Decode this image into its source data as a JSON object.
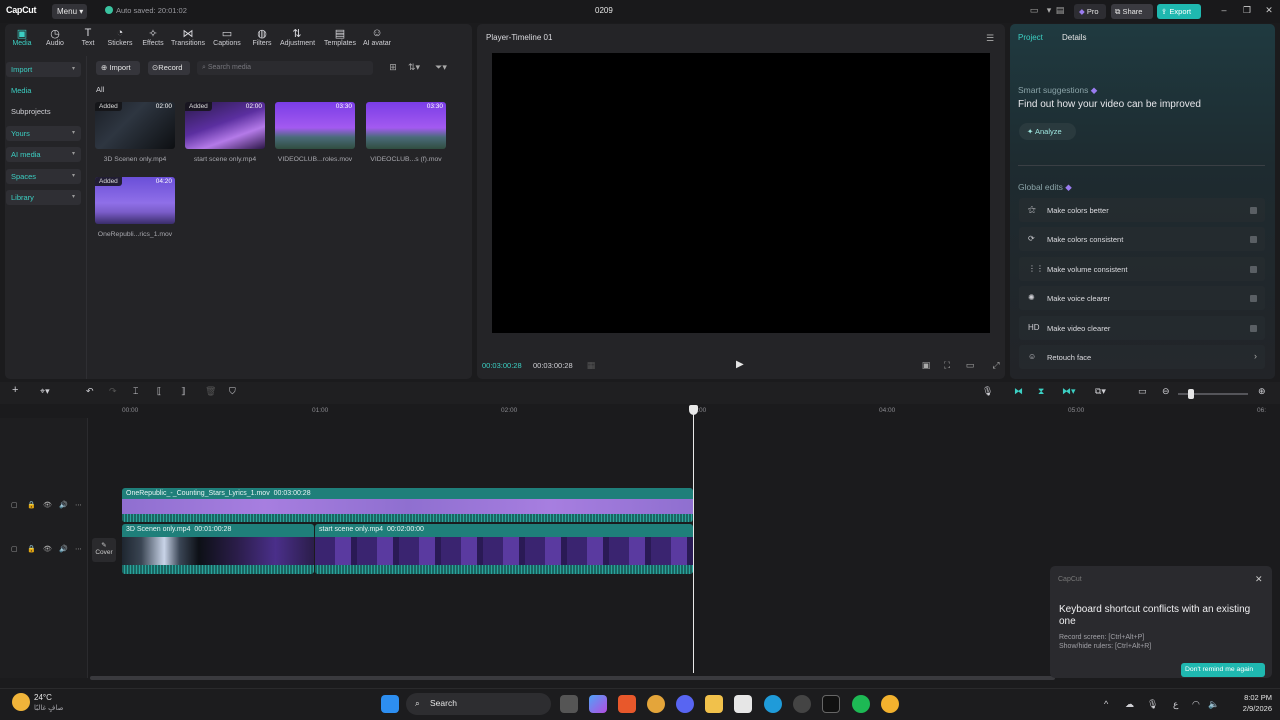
{
  "titlebar": {
    "logo": "CapCut",
    "menu_label": "Menu",
    "autosave": "Auto saved: 20:01:02",
    "project_name": "0209",
    "pro_label": "Pro",
    "share_label": "Share",
    "export_label": "Export"
  },
  "toolbar": {
    "items": [
      {
        "label": "Media",
        "icon": "media-icon"
      },
      {
        "label": "Audio",
        "icon": "audio-icon"
      },
      {
        "label": "Text",
        "icon": "text-icon"
      },
      {
        "label": "Stickers",
        "icon": "stickers-icon"
      },
      {
        "label": "Effects",
        "icon": "effects-icon"
      },
      {
        "label": "Transitions",
        "icon": "transitions-icon"
      },
      {
        "label": "Captions",
        "icon": "captions-icon"
      },
      {
        "label": "Filters",
        "icon": "filters-icon"
      },
      {
        "label": "Adjustment",
        "icon": "adjustment-icon"
      },
      {
        "label": "Templates",
        "icon": "templates-icon"
      },
      {
        "label": "AI avatar",
        "icon": "ai-avatar-icon"
      }
    ]
  },
  "sidebar": {
    "items": [
      {
        "label": "Import"
      },
      {
        "label": "Media"
      },
      {
        "label": "Subprojects"
      },
      {
        "label": "Yours"
      },
      {
        "label": "AI media"
      },
      {
        "label": "Spaces"
      },
      {
        "label": "Library"
      }
    ]
  },
  "media": {
    "import_label": "Import",
    "record_label": "Record",
    "search_placeholder": "Search media",
    "filter_all": "All",
    "items": [
      {
        "name": "3D Scenen only.mp4",
        "badge": "Added",
        "duration": "02:00"
      },
      {
        "name": "start scene only.mp4",
        "badge": "Added",
        "duration": "02:00"
      },
      {
        "name": "VIDEOCLUB...roles.mov",
        "badge": "",
        "duration": "03:30"
      },
      {
        "name": "VIDEOCLUB...s (f).mov",
        "badge": "",
        "duration": "03:30"
      },
      {
        "name": "OneRepubli...rics_1.mov",
        "badge": "Added",
        "duration": "04:20"
      }
    ]
  },
  "player": {
    "title": "Player-Timeline 01",
    "current_time": "00:03:00:28",
    "total_time": "00:03:00:28"
  },
  "details": {
    "tab_project": "Project",
    "tab_details": "Details",
    "smart_title": "Smart suggestions",
    "smart_sub": "Find out how your video can be improved",
    "analyze_label": "Analyze",
    "global_title": "Global edits",
    "edits": [
      {
        "label": "Make colors better",
        "icon": "magic-wand-icon"
      },
      {
        "label": "Make colors consistent",
        "icon": "color-sync-icon"
      },
      {
        "label": "Make volume consistent",
        "icon": "volume-bars-icon"
      },
      {
        "label": "Make voice clearer",
        "icon": "voice-sparkle-icon"
      },
      {
        "label": "Make video clearer",
        "icon": "hd-icon",
        "icon_text": "HD"
      },
      {
        "label": "Retouch face",
        "icon": "face-retouch-icon"
      }
    ]
  },
  "timeline": {
    "ruler": [
      "00:00",
      "01:00",
      "02:00",
      "03:00",
      "04:00",
      "05:00",
      "06:"
    ],
    "overlay_clip": {
      "name": "OneRepublic_-_Counting_Stars_Lyrics_1.mov",
      "duration": "00:03:00:28"
    },
    "main_clips": [
      {
        "name": "3D Scenen only.mp4",
        "duration": "00:01:00:28"
      },
      {
        "name": "start scene only.mp4",
        "duration": "00:02:00:00"
      }
    ],
    "cover_label": "Cover"
  },
  "toast": {
    "app": "CapCut",
    "title": "Keyboard shortcut conflicts with an existing one",
    "line1": "Record screen: [Ctrl+Alt+P]",
    "line2": "Show/hide rulers: [Ctrl+Alt+R]",
    "button": "Don't remind me again"
  },
  "taskbar": {
    "temp": "24°C",
    "weather": "صافٍ غالبًا",
    "search": "Search",
    "lang": "ع",
    "time": "8:02 PM",
    "date": "2/9/2026"
  },
  "colors": {
    "accent": "#3ccfc3",
    "export": "#1fb8b0",
    "clip": "#1f7f7a",
    "overlay_strip": "#a77ee0"
  }
}
